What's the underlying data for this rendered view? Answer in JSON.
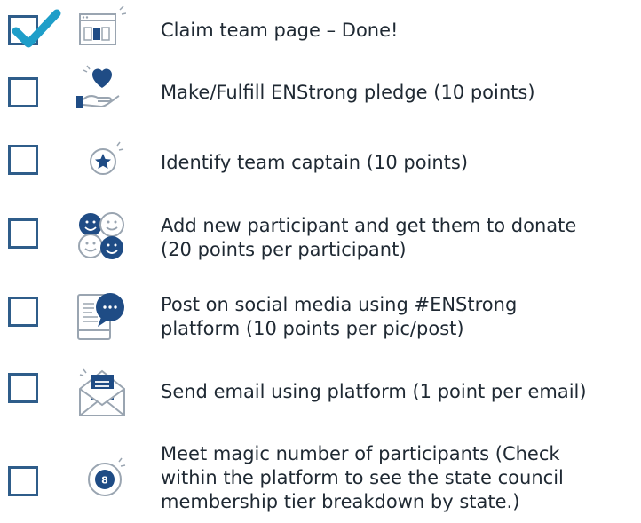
{
  "checklist": {
    "items": [
      {
        "icon": "webpage-icon",
        "checked": true,
        "lines": [
          "Claim team page – Done!"
        ]
      },
      {
        "icon": "hand-heart-icon",
        "checked": false,
        "lines": [
          "Make/Fulfill ENStrong pledge (10 points)"
        ]
      },
      {
        "icon": "star-badge-icon",
        "checked": false,
        "lines": [
          "Identify team captain (10 points)"
        ]
      },
      {
        "icon": "smiley-group-icon",
        "checked": false,
        "lines": [
          "Add new participant and get them to donate",
          "(20 points per participant)"
        ]
      },
      {
        "icon": "phone-chat-icon",
        "checked": false,
        "lines": [
          "Post on social media using #ENStrong",
          "platform (10 points per pic/post)"
        ]
      },
      {
        "icon": "envelope-letter-icon",
        "checked": false,
        "lines": [
          "Send email using platform (1 point per email)"
        ]
      },
      {
        "icon": "number-eight-badge-icon",
        "badge_text": "8",
        "checked": false,
        "lines": [
          "Meet magic number of participants (Check",
          "within the platform to see the state council",
          "membership tier breakdown by state.)"
        ]
      }
    ]
  },
  "colors": {
    "checkbox_border": "#2f5d8a",
    "checkmark": "#1e9ec9",
    "icon_navy": "#1f4c85",
    "icon_outline": "#9aa5b1",
    "text": "#1f2933"
  }
}
